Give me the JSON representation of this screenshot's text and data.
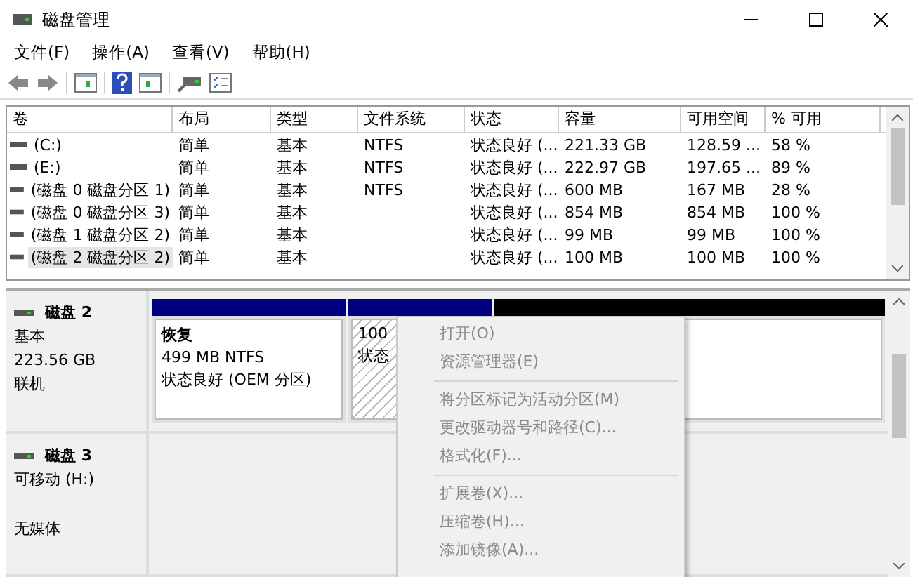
{
  "window": {
    "title": "磁盘管理"
  },
  "menu": [
    "文件(F)",
    "操作(A)",
    "查看(V)",
    "帮助(H)"
  ],
  "table": {
    "columns": [
      "卷",
      "布局",
      "类型",
      "文件系统",
      "状态",
      "容量",
      "可用空间",
      "% 可用"
    ],
    "rows": [
      {
        "cells": [
          "(C:)",
          "简单",
          "基本",
          "NTFS",
          "状态良好 (...",
          "221.33 GB",
          "128.59 ...",
          "58 %"
        ],
        "selected": false
      },
      {
        "cells": [
          "(E:)",
          "简单",
          "基本",
          "NTFS",
          "状态良好 (...",
          "222.97 GB",
          "197.65 ...",
          "89 %"
        ],
        "selected": false
      },
      {
        "cells": [
          "(磁盘 0 磁盘分区 1)",
          "简单",
          "基本",
          "NTFS",
          "状态良好 (...",
          "600 MB",
          "167 MB",
          "28 %"
        ],
        "selected": false
      },
      {
        "cells": [
          "(磁盘 0 磁盘分区 3)",
          "简单",
          "基本",
          "",
          "状态良好 (...",
          "854 MB",
          "854 MB",
          "100 %"
        ],
        "selected": false
      },
      {
        "cells": [
          "(磁盘 1 磁盘分区 2)",
          "简单",
          "基本",
          "",
          "状态良好 (...",
          "99 MB",
          "99 MB",
          "100 %"
        ],
        "selected": false
      },
      {
        "cells": [
          "(磁盘 2 磁盘分区 2)",
          "简单",
          "基本",
          "",
          "状态良好 (...",
          "100 MB",
          "100 MB",
          "100 %"
        ],
        "selected": true
      }
    ]
  },
  "disks": [
    {
      "name": "磁盘 2",
      "lines": [
        "基本",
        "223.56 GB",
        "联机"
      ],
      "partitions": [
        {
          "kind": "primary",
          "selected": false,
          "title": "恢复",
          "lines": [
            "499 MB NTFS",
            "状态良好 (OEM 分区)"
          ]
        },
        {
          "kind": "primary",
          "selected": true,
          "lines": [
            "100",
            "状态"
          ]
        },
        {
          "kind": "unallocated",
          "selected": false
        }
      ]
    },
    {
      "name": "磁盘 3",
      "lines": [
        "可移动 (H:)"
      ],
      "media": "无媒体"
    }
  ],
  "context_menu": {
    "groups": [
      [
        {
          "label": "打开(O)",
          "disabled": true
        },
        {
          "label": "资源管理器(E)",
          "disabled": true
        }
      ],
      [
        {
          "label": "将分区标记为活动分区(M)",
          "disabled": true
        },
        {
          "label": "更改驱动器号和路径(C)...",
          "disabled": true
        },
        {
          "label": "格式化(F)...",
          "disabled": true
        }
      ],
      [
        {
          "label": "扩展卷(X)...",
          "disabled": true
        },
        {
          "label": "压缩卷(H)...",
          "disabled": true
        },
        {
          "label": "添加镜像(A)...",
          "disabled": true
        }
      ]
    ]
  }
}
